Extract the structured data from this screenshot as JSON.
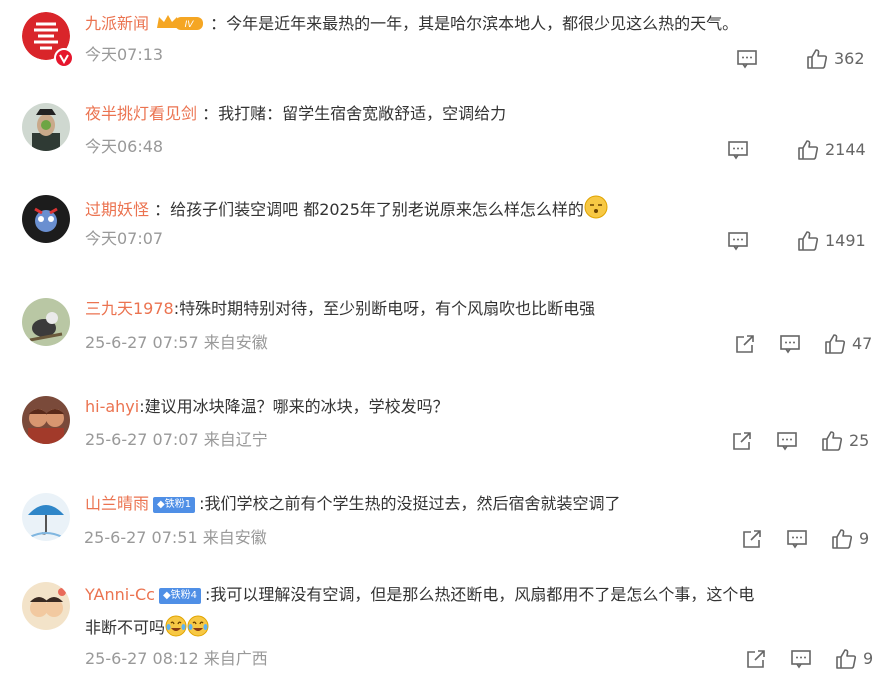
{
  "comments": [
    {
      "name": "九派新闻",
      "sep": " ：",
      "text": "今年是近年来最热的一年，其是哈尔滨本地人，都很少见这么热的天气。",
      "time": "今天07:13",
      "likes": "362",
      "badge": "IV"
    },
    {
      "name": "夜半挑灯看见剑",
      "sep": " ：",
      "text": "我打赌：留学生宿舍宽敞舒适，空调给力",
      "time": "今天06:48",
      "likes": "2144"
    },
    {
      "name": "过期妖怪",
      "sep": " ：",
      "text": "给孩子们装空调吧 都2025年了别老说原来怎么样怎么样的",
      "time": "今天07:07",
      "likes": "1491"
    },
    {
      "name": "三九天1978",
      "sep": ":",
      "text": "特殊时期特别对待，至少别断电呀，有个风扇吹也比断电强",
      "time": "25-6-27 07:57 来自安徽",
      "likes": "47"
    },
    {
      "name": "hi-ahyi",
      "sep": ":",
      "text": "建议用冰块降温？哪来的冰块，学校发吗？",
      "time": "25-6-27 07:07 来自辽宁",
      "likes": "25"
    },
    {
      "name": "山兰晴雨",
      "fan": "铁粉1",
      "sep": ":",
      "text": "我们学校之前有个学生热的没挺过去，然后宿舍就装空调了",
      "time": "25-6-27 07:51 来自安徽",
      "likes": "9"
    },
    {
      "name": "YAnni-Cc",
      "fan": "铁粉4",
      "sep": ":",
      "text": "我可以理解没有空调，但是那么热还断电，风扇都用不了是怎么个事，这个电",
      "text2": "非断不可吗",
      "time": "25-6-27 08:12 来自广西",
      "likes": "9"
    }
  ],
  "colors": {
    "name": "#eb7350",
    "meta": "#999999",
    "text": "#333333",
    "icon": "#666666"
  },
  "icons": {
    "comment": "comment-icon",
    "like": "thumbs-up-icon",
    "share": "share-icon"
  }
}
